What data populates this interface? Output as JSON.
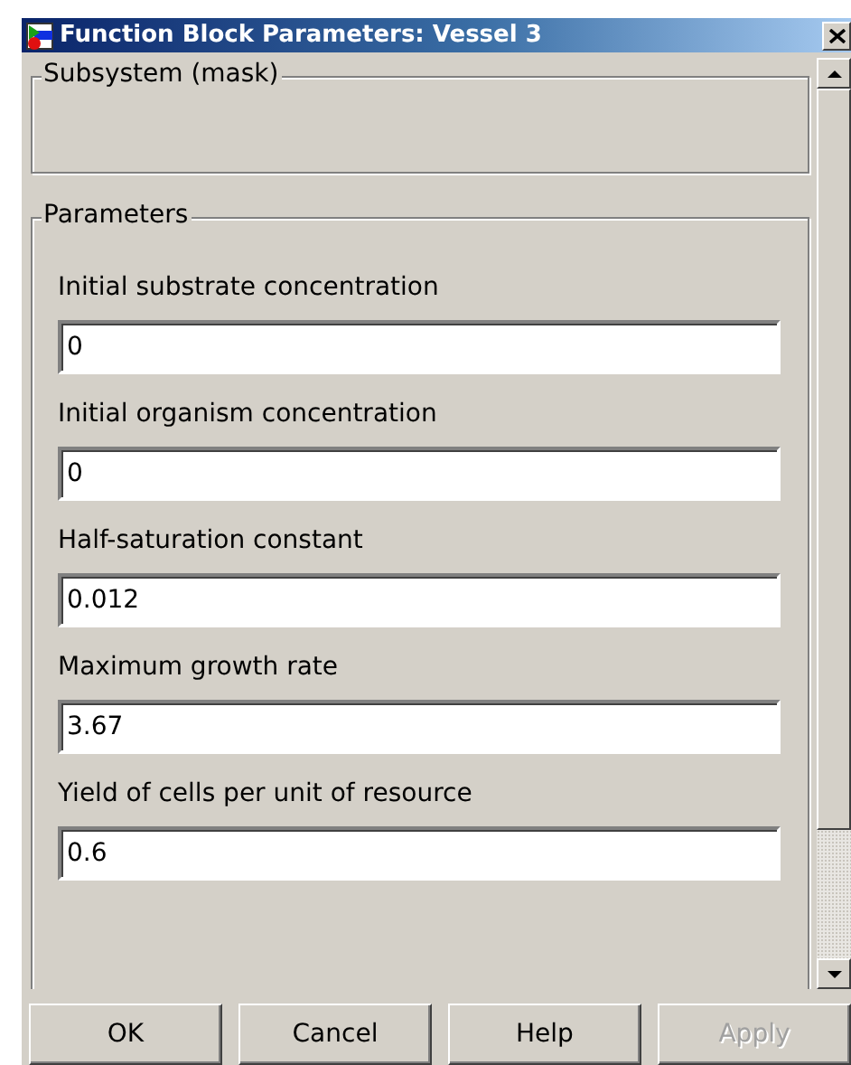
{
  "window": {
    "title": "Function Block Parameters: Vessel 3"
  },
  "subsystem": {
    "legend": "Subsystem (mask)"
  },
  "parameters": {
    "legend": "Parameters",
    "fields": [
      {
        "label": "Initial substrate concentration",
        "value": "0"
      },
      {
        "label": "Initial organism concentration",
        "value": "0"
      },
      {
        "label": "Half-saturation constant",
        "value": "0.012"
      },
      {
        "label": "Maximum growth rate",
        "value": "3.67"
      },
      {
        "label": "Yield of cells per unit of resource",
        "value": "0.6"
      }
    ]
  },
  "buttons": [
    {
      "label": "OK",
      "disabled": false
    },
    {
      "label": "Cancel",
      "disabled": false
    },
    {
      "label": "Help",
      "disabled": false
    },
    {
      "label": "Apply",
      "disabled": true
    }
  ]
}
